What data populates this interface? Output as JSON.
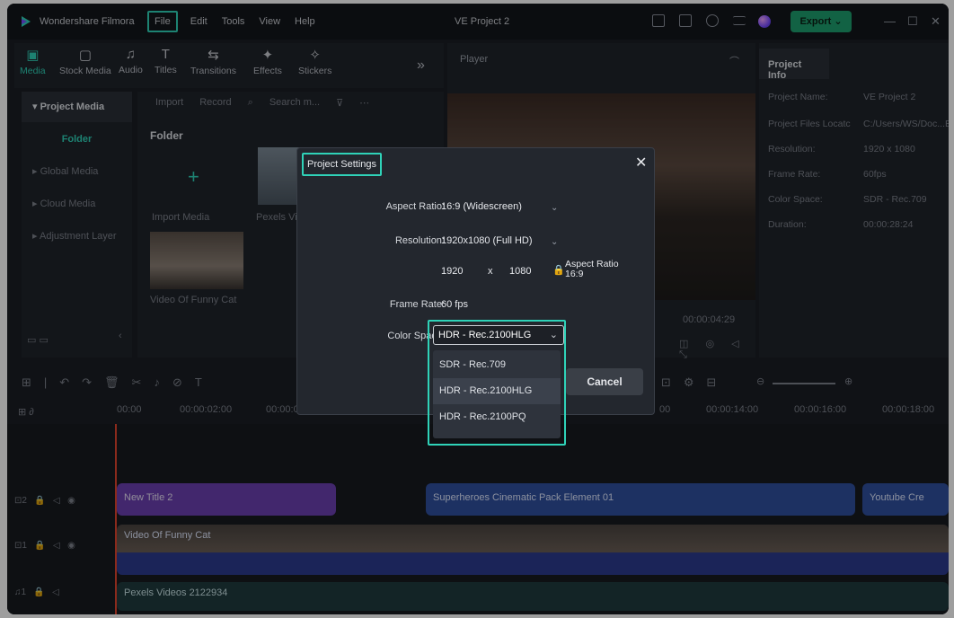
{
  "app": {
    "name": "Wondershare Filmora",
    "project_title": "VE Project 2",
    "export_label": "Export"
  },
  "menu": [
    "File",
    "Edit",
    "Tools",
    "View",
    "Help"
  ],
  "media_tabs": [
    "Media",
    "Stock Media",
    "Audio",
    "Titles",
    "Transitions",
    "Effects",
    "Stickers"
  ],
  "sidebar": {
    "items": [
      "Project Media",
      "Folder",
      "Global Media",
      "Cloud Media",
      "Adjustment Layer"
    ]
  },
  "media_toolbar": {
    "import": "Import",
    "record": "Record",
    "search_placeholder": "Search m..."
  },
  "media_area": {
    "folder_title": "Folder",
    "import_label": "Import Media",
    "pexels_label": "Pexels Vid",
    "video_label": "Video Of Funny Cat"
  },
  "player": {
    "label": "Player",
    "timecode": "00:00:04:29"
  },
  "project_info": {
    "title": "Project Info",
    "rows": [
      {
        "label": "Project Name:",
        "value": "VE Project 2"
      },
      {
        "label": "Project Files Locatc",
        "value": "C:/Users/WS/Doc...E"
      },
      {
        "label": "Resolution:",
        "value": "1920 x 1080"
      },
      {
        "label": "Frame Rate:",
        "value": "60fps"
      },
      {
        "label": "Color Space:",
        "value": "SDR - Rec.709"
      },
      {
        "label": "Duration:",
        "value": "00:00:28:24"
      }
    ]
  },
  "ruler": [
    "00:00",
    "00:00:02:00",
    "00:00:0",
    "00",
    "00:00:14:00",
    "00:00:16:00",
    "00:00:18:00"
  ],
  "tracks": {
    "title_clip": "New Title 2",
    "effect_clip": "Superheroes Cinematic Pack Element 01",
    "yt_clip": "Youtube Cre",
    "video_clip": "Video Of Funny Cat",
    "audio_clip": "Pexels Videos 2122934"
  },
  "dialog": {
    "title": "Project Settings",
    "aspect_label": "Aspect Ratio:",
    "aspect_value": "16:9 (Widescreen)",
    "resolution_label": "Resolution:",
    "resolution_value": "1920x1080 (Full HD)",
    "width": "1920",
    "x": "x",
    "height": "1080",
    "aspect_lock": "Aspect Ratio",
    "aspect_lock_value": "16:9",
    "framerate_label": "Frame Rate:",
    "framerate_value": "60 fps",
    "colorspace_label": "Color Space:",
    "colorspace_value": "HDR - Rec.2100HLG",
    "options": [
      "SDR - Rec.709",
      "HDR - Rec.2100HLG",
      "HDR - Rec.2100PQ"
    ],
    "cancel": "Cancel"
  }
}
